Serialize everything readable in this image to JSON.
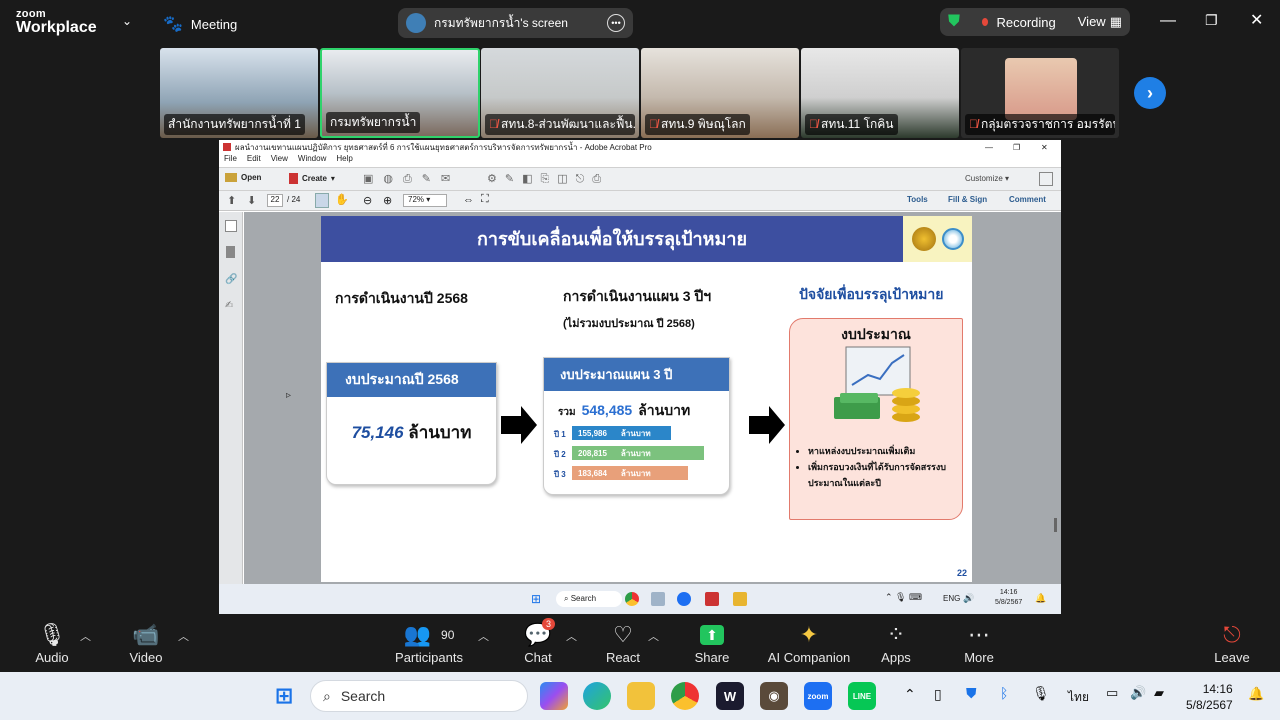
{
  "app": {
    "logo_top": "zoom",
    "logo_bottom": "Workplace",
    "meeting_label": "Meeting"
  },
  "share_pill": {
    "text": "กรมทรัพยากรน้ำ's screen"
  },
  "recording": {
    "label": "Recording",
    "view_label": "View"
  },
  "thumbnails": [
    {
      "name": "สำนักงานทรัพยากรน้ำที่ 1",
      "muted": false
    },
    {
      "name": "กรมทรัพยากรน้ำ",
      "muted": false
    },
    {
      "name": "สทน.8-ส่วนพัฒนาและฟื้น...",
      "muted": true
    },
    {
      "name": "สทน.9 พิษณุโลก",
      "muted": true
    },
    {
      "name": "สทน.11 โกคิน",
      "muted": true
    },
    {
      "name": "กลุ่มตรวจราชการ อมรรัตน์",
      "muted": true
    }
  ],
  "acrobat": {
    "title": "ผลนำงานเขทานแผนปฏิบัติการ ยุทธศาสตร์ที่ 6 การใช้แผนยุทธศาสตร์การบริหารจัดการทรัพยากรน้ำ - Adobe Acrobat Pro",
    "menu": [
      "File",
      "Edit",
      "View",
      "Window",
      "Help"
    ],
    "open_label": "Open",
    "create_label": "Create",
    "customize_label": "Customize",
    "page_current": "22",
    "page_total": "/ 24",
    "zoom": "72%",
    "tools_label": "Tools",
    "fill_sign_label": "Fill & Sign",
    "comment_label": "Comment"
  },
  "slide": {
    "title": "การขับเคลื่อนเพื่อให้บรรลุเป้าหมาย",
    "col1_heading": "การดำเนินงานปี 2568",
    "col2_heading": "การดำเนินงานแผน 3 ปีฯ",
    "col2_sub": "(ไม่รวมงบประมาณ ปี 2568)",
    "col3_heading": "ปัจจัยเพื่อบรรลุเป้าหมาย",
    "card1_head": "งบประมาณปี 2568",
    "card1_value": "75,146",
    "card1_unit": "ล้านบาท",
    "card2_head": "งบประมาณแผน 3 ปี",
    "card2_total_label": "รวม",
    "card2_total_value": "548,485",
    "card2_total_unit": "ล้านบาท",
    "bars": [
      {
        "label": "ปี 1",
        "value": "155,986",
        "unit": "ล้านบาท",
        "color": "#2b86c9",
        "ratio": 0.75
      },
      {
        "label": "ปี 2",
        "value": "208,815",
        "unit": "ล้านบาท",
        "color": "#7cc27e",
        "ratio": 1.0
      },
      {
        "label": "ปี 3",
        "value": "183,684",
        "unit": "ล้านบาท",
        "color": "#e8a07a",
        "ratio": 0.88
      }
    ],
    "card3_head": "งบประมาณ",
    "bullets": [
      "หาแหล่งงบประมาณเพิ่มเติม",
      "เพิ่มกรอบวงเงินที่ได้รับการจัดสรรงบประมาณในแต่ละปี"
    ],
    "page_no": "22"
  },
  "remote_taskbar": {
    "search": "Search",
    "lang": "ENG",
    "time": "14:16",
    "date": "5/8/2567"
  },
  "controls": {
    "audio": "Audio",
    "video": "Video",
    "participants": "Participants",
    "participants_count": "90",
    "chat": "Chat",
    "chat_badge": "3",
    "react": "React",
    "share": "Share",
    "ai": "AI Companion",
    "apps": "Apps",
    "more": "More",
    "leave": "Leave"
  },
  "taskbar": {
    "search": "Search",
    "lang": "ไทย",
    "time": "14:16",
    "date": "5/8/2567"
  },
  "colors": {
    "accent_green": "#22c55e",
    "record_red": "#e5483a",
    "slide_blue": "#3d4fa0"
  }
}
